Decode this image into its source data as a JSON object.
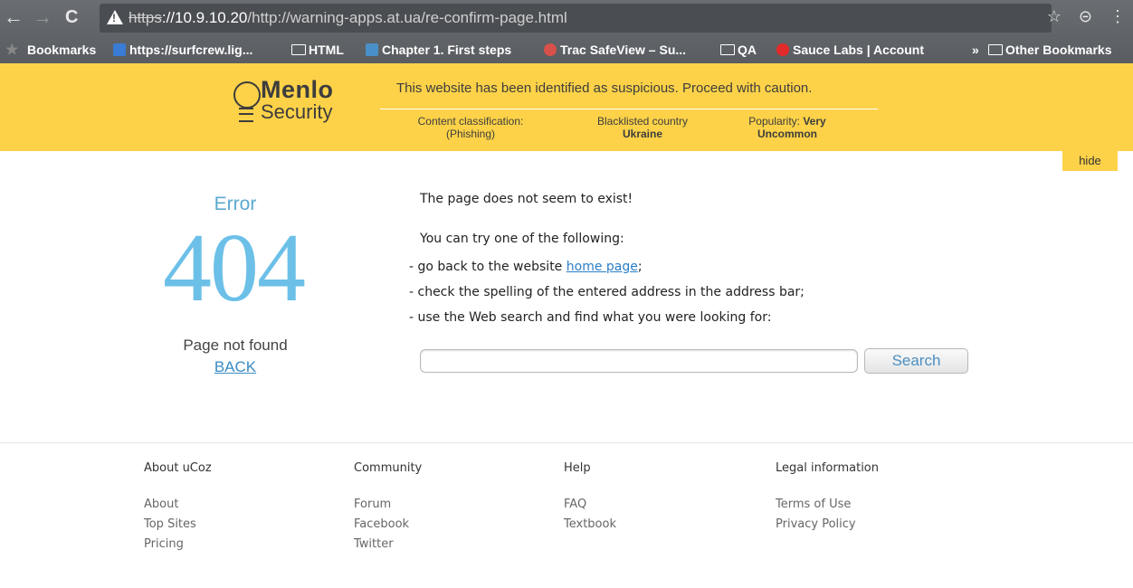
{
  "browser": {
    "nav": {
      "back": "←",
      "forward": "→",
      "reload": "C"
    },
    "url": {
      "protocol": "https",
      "host": "://10.9.10.20",
      "path": "/http://warning-apps.at.ua/re-confirm-page.html"
    },
    "right_icons": {
      "star": "☆",
      "menu": "⊝",
      "more": "⋮"
    },
    "bookmarks": [
      {
        "label": "Bookmarks",
        "icon": "star-icon"
      },
      {
        "label": "https://surfcrew.lig...",
        "icon": "site-favicon"
      },
      {
        "label": "HTML",
        "icon": "folder-icon"
      },
      {
        "label": "Chapter 1. First steps",
        "icon": "site-favicon"
      },
      {
        "label": "Trac SafeView – Su...",
        "icon": "trac-icon"
      },
      {
        "label": "QA",
        "icon": "folder-icon"
      },
      {
        "label": "Sauce Labs | Account",
        "icon": "sauce-labs-icon"
      },
      {
        "label": "»",
        "icon": "chevron-icon"
      },
      {
        "label": "Other Bookmarks",
        "icon": "folder-icon"
      }
    ]
  },
  "banner": {
    "logo_top": "Menlo",
    "logo_bottom": "Security",
    "message": "This website has been identified as suspicious. Proceed with caution.",
    "classification_label": "Content classification:",
    "classification_value": "(Phishing)",
    "country_label": "Blacklisted country",
    "country_value": "Ukraine",
    "popularity_label": "Popularity:",
    "popularity_value_1": "Very",
    "popularity_value_2": "Uncommon",
    "hide": "hide"
  },
  "error": {
    "label": "Error",
    "code": "404",
    "subtitle": "Page not found",
    "back": "BACK"
  },
  "content": {
    "headline": "The page does not seem to exist!",
    "intro": "You can try one of the following:",
    "option1_prefix": "- go back to the website ",
    "option1_link": "home page",
    "option1_suffix": ";",
    "option2": "- check the spelling of the entered address in the address bar;",
    "option3": "- use the Web search and find what you were looking for:",
    "search_value": "",
    "search_button": "Search"
  },
  "footer": {
    "columns": [
      {
        "title": "About uCoz",
        "links": [
          "About",
          "Top Sites",
          "Pricing"
        ]
      },
      {
        "title": "Community",
        "links": [
          "Forum",
          "Facebook",
          "Twitter"
        ]
      },
      {
        "title": "Help",
        "links": [
          "FAQ",
          "Textbook"
        ]
      },
      {
        "title": "Legal information",
        "links": [
          "Terms of Use",
          "Privacy Policy"
        ]
      }
    ]
  },
  "colors": {
    "banner": "#fdd248",
    "error_blue": "#6cc0e8",
    "link_blue": "#2a7ec6"
  }
}
